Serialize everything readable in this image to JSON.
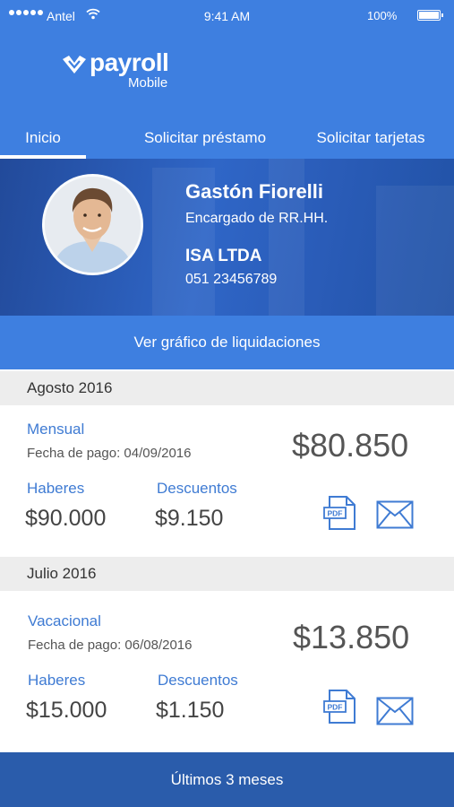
{
  "status_bar": {
    "carrier": "Antel",
    "time": "9:41 AM",
    "battery": "100%"
  },
  "header": {
    "logo_text": "payroll",
    "logo_sub": "Mobile"
  },
  "tabs": [
    {
      "label": "Inicio",
      "active": true
    },
    {
      "label": "Solicitar préstamo",
      "active": false
    },
    {
      "label": "Solicitar tarjetas",
      "active": false
    }
  ],
  "profile": {
    "name": "Gastón Fiorelli",
    "role": "Encargado de RR.HH.",
    "company": "ISA LTDA",
    "phone": "051 23456789"
  },
  "chart_button": "Ver gráfico de liquidaciones",
  "payslips": [
    {
      "month": "Agosto 2016",
      "type": "Mensual",
      "pay_date": "Fecha de pago: 04/09/2016",
      "net": "$80.850",
      "haberes_label": "Haberes",
      "haberes": "$90.000",
      "descuentos_label": "Descuentos",
      "descuentos": "$9.150"
    },
    {
      "month": "Julio 2016",
      "type": "Vacacional",
      "pay_date": "Fecha de pago: 06/08/2016",
      "net": "$13.850",
      "haberes_label": "Haberes",
      "haberes": "$15.000",
      "descuentos_label": "Descuentos",
      "descuentos": "$1.150"
    }
  ],
  "icons": {
    "pdf_label": "PDF"
  },
  "footer": "Últimos 3 meses",
  "colors": {
    "primary": "#3e7fe0",
    "dark": "#2a5cab",
    "accent_text": "#3f7bd3"
  }
}
